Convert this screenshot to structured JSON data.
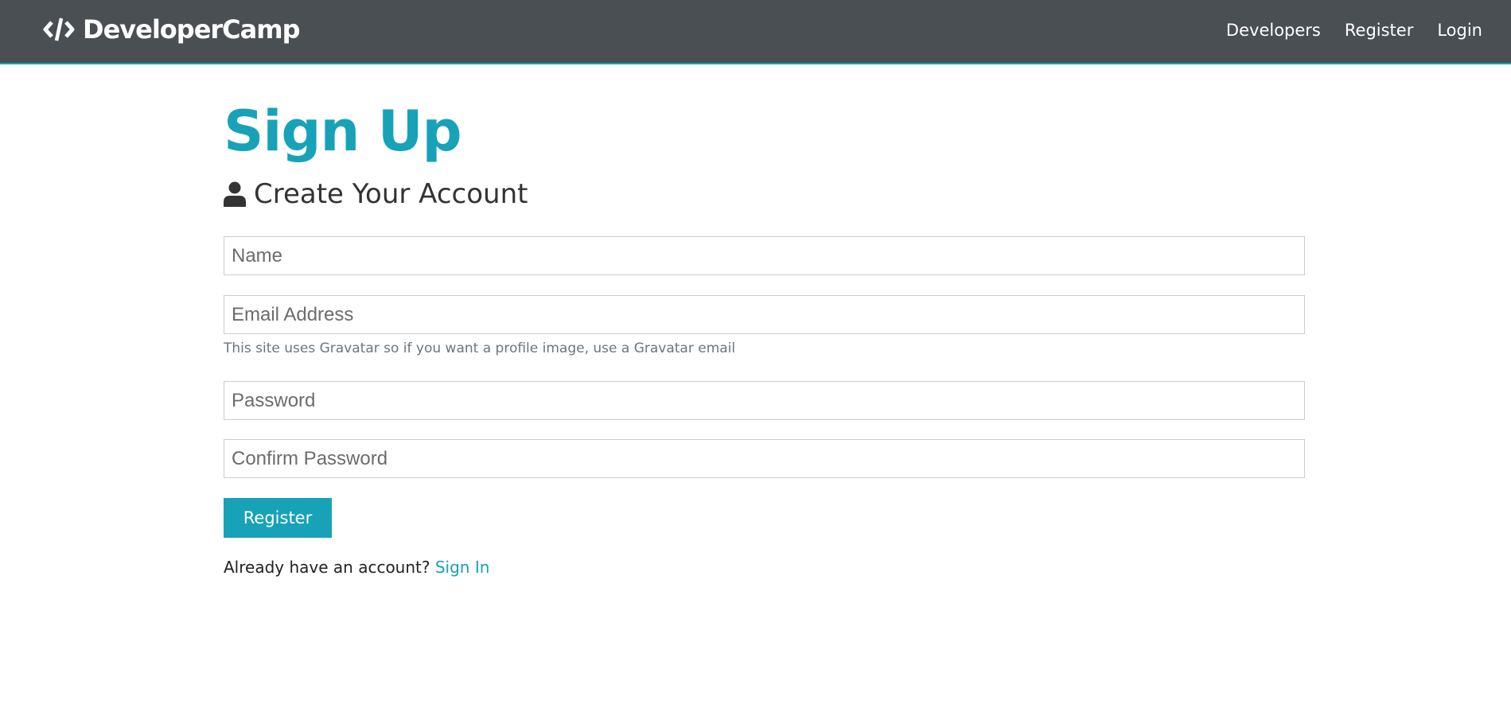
{
  "nav": {
    "brand": "DeveloperCamp",
    "links": [
      "Developers",
      "Register",
      "Login"
    ]
  },
  "page": {
    "title": "Sign Up",
    "subtitle": "Create Your Account",
    "fields": {
      "name_placeholder": "Name",
      "email_placeholder": "Email Address",
      "email_help": "This site uses Gravatar so if you want a profile image, use a Gravatar email",
      "password_placeholder": "Password",
      "confirm_placeholder": "Confirm Password"
    },
    "submit_label": "Register",
    "already_text": "Already have an account?",
    "signin_link": "Sign In"
  },
  "colors": {
    "accent": "#17a2b8",
    "navbar": "#4a4f54"
  }
}
